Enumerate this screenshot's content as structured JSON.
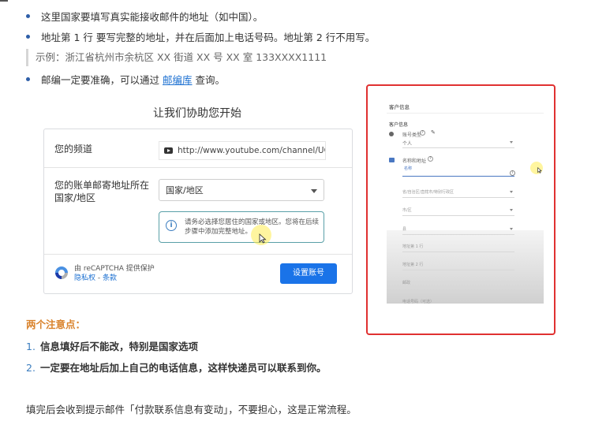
{
  "intro": {
    "bullet1": "这里国家要填写真实能接收邮件的地址（如中国）。",
    "bullet2": "地址第 1 行 要写完整的地址，并在后面加上电话号码。地址第 2 行不用写。",
    "example": "示例：浙江省杭州市余杭区 XX 街道 XX 号 XX 室 133XXXX1111",
    "bullet3_prefix": "邮编一定要准确，可以通过",
    "bullet3_link": "邮编库",
    "bullet3_suffix": "查询。"
  },
  "form": {
    "title": "让我们协助您开始",
    "channel_label": "您的频道",
    "channel_url": "http://www.youtube.com/channel/UC9btt...",
    "country_label": "您的账单邮寄地址所在国家/地区",
    "country_select_value": "国家/地区",
    "notice_text": "请务必选择您居住的国家或地区。您将在后续步骤中添加完整地址。",
    "recaptcha_line1": "由 reCAPTCHA 提供保护",
    "recaptcha_privacy": "隐私权",
    "recaptcha_sep": " - ",
    "recaptcha_terms": "条款",
    "setup_button": "设置账号"
  },
  "mobile": {
    "heading": "客户信息",
    "section": "客户信息",
    "account_type_label": "账号类型",
    "account_type_value": "个人",
    "address_label": "名称和地址",
    "name_value": "名称",
    "field1": "省/自治区/直辖市/特别行政区",
    "field2": "市/区",
    "field3": "县",
    "field4": "地址第 1 行",
    "field5": "地址第 2 行",
    "field6": "邮政",
    "field7": "电话号码（可选）",
    "colors": {
      "frame": "#e03131",
      "accent": "#4a78c2"
    }
  },
  "notes": {
    "title": "两个注意点：",
    "items": [
      {
        "num": "1.",
        "text": "信息填好后不能改，特别是国家选项"
      },
      {
        "num": "2.",
        "text": "一定要在地址后加上自己的电话信息，这样快递员可以联系到你。"
      }
    ]
  },
  "footer": "填完后会收到提示邮件「付款联系信息有变动」，不要担心，这是正常流程。",
  "icons": {
    "bullet": "bullet-dot-icon",
    "youtube": "youtube-icon",
    "info": "info-icon",
    "recaptcha": "recaptcha-icon",
    "dropdown": "chevron-down-icon",
    "person": "person-icon",
    "address": "building-icon",
    "help": "help-circle-icon",
    "edit": "pencil-icon"
  }
}
